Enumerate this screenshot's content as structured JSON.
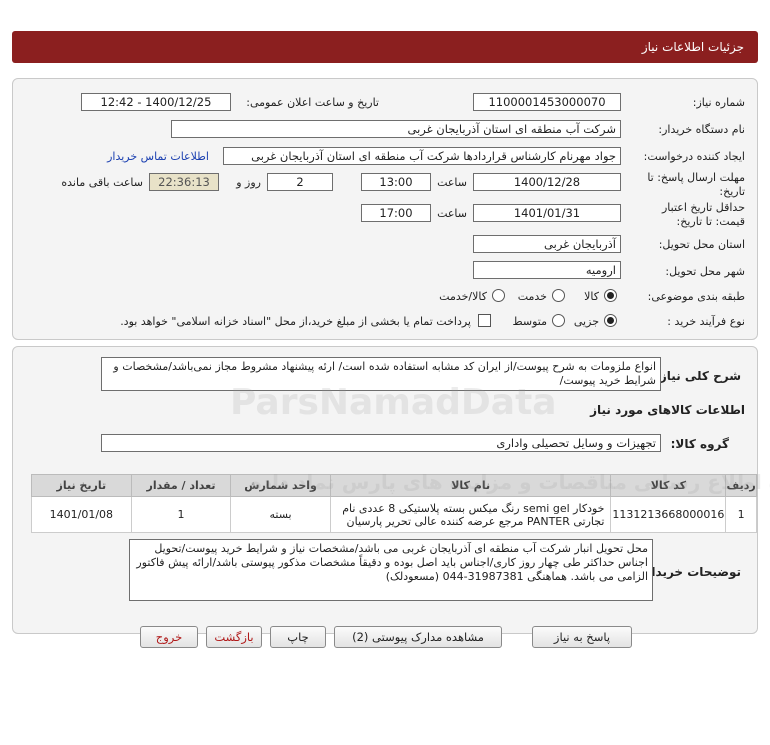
{
  "title": "جزئیات اطلاعات نیاز",
  "form": {
    "need_number_label": "شماره نیاز:",
    "need_number": "1100001453000070",
    "announce_label": "تاریخ و ساعت اعلان عمومی:",
    "announce_value": "1400/12/25 - 12:42",
    "buyer_org_label": "نام دستگاه خریدار:",
    "buyer_org": "شرکت آب منطقه ای استان آذربایجان غربی",
    "requester_label": "ایجاد کننده درخواست:",
    "requester": "جواد مهرنام کارشناس قراردادها شرکت آب منطقه ای استان آذربایجان غربی",
    "contact_link": "اطلاعات تماس خریدار",
    "deadline_label_1": "مهلت ارسال پاسخ: تا",
    "deadline_label_2": "تاریخ:",
    "deadline_date": "1400/12/28",
    "time_label": "ساعت",
    "deadline_time": "13:00",
    "days_value": "2",
    "days_label": "روز و",
    "remaining_time": "22:36:13",
    "remaining_label": "ساعت باقی مانده",
    "validity_label_1": "حداقل تاریخ اعتبار",
    "validity_label_2": "قیمت: تا تاریخ:",
    "validity_date": "1401/01/31",
    "validity_time_label": "ساعت",
    "validity_time": "17:00",
    "province_label": "استان محل تحویل:",
    "province": "آذربایجان غربی",
    "city_label": "شهر محل تحویل:",
    "city": "ارومیه",
    "category_label": "طبقه بندی موضوعی:",
    "category_options": [
      "کالا",
      "خدمت",
      "کالا/خدمت"
    ],
    "category_selected": "کالا",
    "process_label": "نوع فرآیند خرید :",
    "process_options": [
      "جزیی",
      "متوسط"
    ],
    "process_selected": "جزیی",
    "payment_note": "پرداخت تمام یا بخشی از مبلغ خرید،از محل \"اسناد خزانه اسلامی\" خواهد بود."
  },
  "details": {
    "general_desc_label": "شرح کلی نیاز:",
    "general_desc": "انواع ملزومات به شرح پیوست/از ایران کد مشابه استفاده شده است/ ارئه پیشنهاد مشروط مجاز نمی‌باشد/مشخصات و شرایط خرید پیوست/",
    "goods_info_label": "اطلاعات کالاهای مورد نیاز",
    "group_label": "گروه کالا:",
    "group_value": "تجهیزات و وسایل تحصیلی واداری",
    "table_headers": [
      "ردیف",
      "کد کالا",
      "نام کالا",
      "واحد شمارش",
      "تعداد / مقدار",
      "تاریخ نیاز"
    ],
    "table_rows": [
      {
        "row": "1",
        "code": "1131213668000016",
        "name": "خودکار semi gel رنگ میکس بسته پلاستیکی 8 عددی نام تجارتی PANTER مرجع عرضه کننده عالی تحریر پارسیان",
        "unit": "بسته",
        "qty": "1",
        "date": "1401/01/08"
      }
    ],
    "buyer_notes_label": "توضیحات خریدار:",
    "buyer_notes": "محل تحویل انبار شرکت آب منطقه ای آذربایجان غربی می باشد/مشخصات نیاز و شرایط خرید پیوست/تحویل اجناس حداکثر طی چهار روز کاری/اجناس باید اصل بوده و دقیقاً مشخصات مذکور پیوستی باشد/ارائه پیش فاکتور الزامی می باشد. هماهنگی 31987381-044 (مسعودلک)"
  },
  "buttons": {
    "reply": "پاسخ به نیاز",
    "attachments": "مشاهده مدارک پیوستی (2)",
    "print": "چاپ",
    "back": "بازگشت",
    "exit": "خروج"
  },
  "watermark": {
    "brand": "ParsNamadData",
    "fa_text": "پایگاه اطلاع رسانی مناقصات و مزایده های پارس نماد داده"
  }
}
